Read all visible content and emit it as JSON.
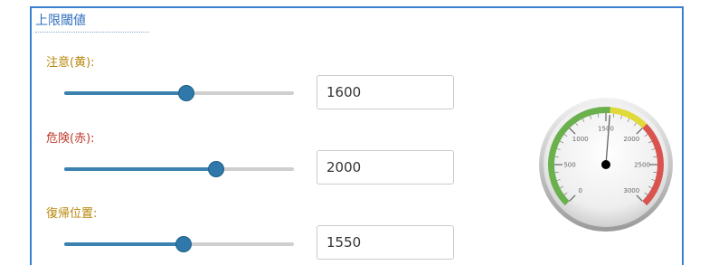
{
  "section": {
    "title": "上限閾値"
  },
  "fields": [
    {
      "key": "warning",
      "label": "注意(黄):",
      "label_color": "#b8860b",
      "value": "1600",
      "slider_fraction": 0.53
    },
    {
      "key": "danger",
      "label": "危険(赤):",
      "label_color": "#c0392b",
      "value": "2000",
      "slider_fraction": 0.66
    },
    {
      "key": "recovery",
      "label": "復帰位置:",
      "label_color": "#b8860b",
      "value": "1550",
      "slider_fraction": 0.52
    }
  ],
  "gauge": {
    "min": 0,
    "max": 3000,
    "needle_value": 1550,
    "tick_labels": [
      "0",
      "500",
      "1000",
      "1500",
      "2000",
      "2500",
      "3000"
    ],
    "bands": [
      {
        "from": 0,
        "to": 1550,
        "color": "#6ab04c"
      },
      {
        "from": 1550,
        "to": 2000,
        "color": "#e1d83a"
      },
      {
        "from": 2000,
        "to": 3000,
        "color": "#d9534f"
      }
    ]
  },
  "colors": {
    "accent": "#3a7fd0",
    "slider": "#2f78a9"
  }
}
